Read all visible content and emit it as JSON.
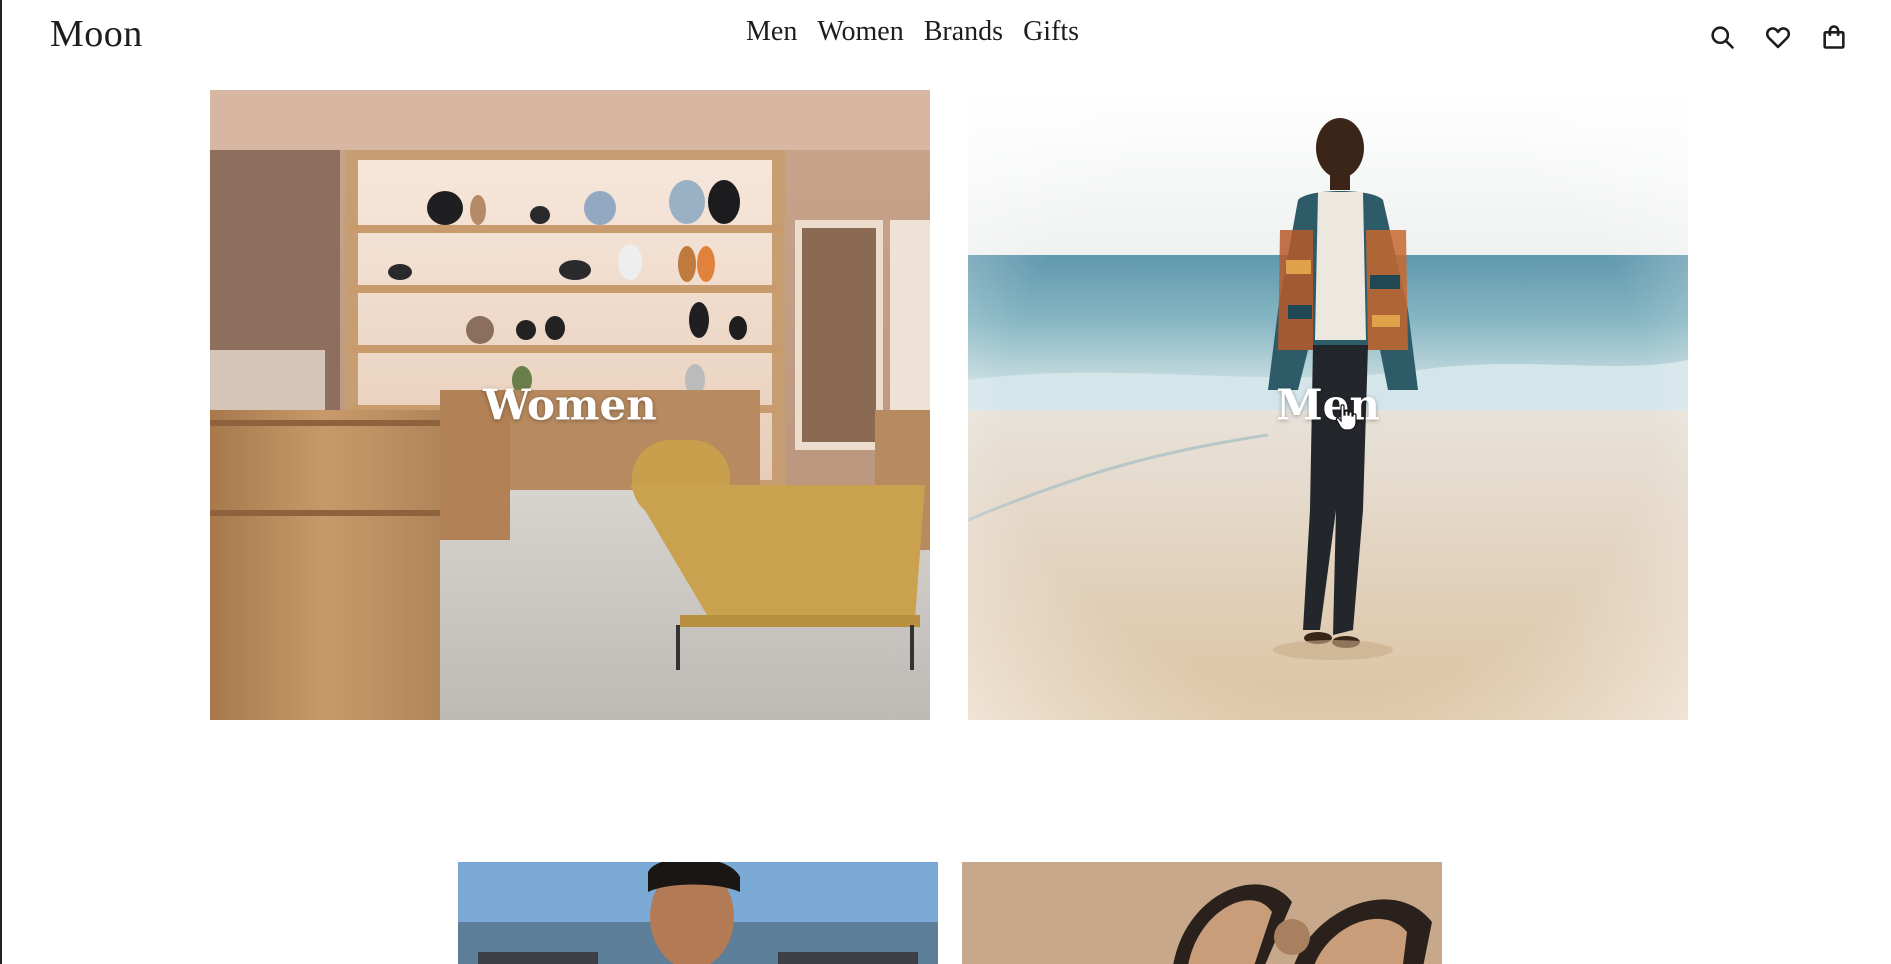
{
  "brand": {
    "logo": "Moon"
  },
  "nav": {
    "items": [
      {
        "label": "Men"
      },
      {
        "label": "Women"
      },
      {
        "label": "Brands"
      },
      {
        "label": "Gifts"
      }
    ]
  },
  "header_icons": [
    "search-icon",
    "heart-icon",
    "shopping-bag-icon"
  ],
  "tiles": {
    "women": {
      "label": "Women"
    },
    "men": {
      "label": "Men"
    }
  },
  "colors": {
    "text": "#1d1d1f",
    "tile_label": "#ffffff"
  }
}
